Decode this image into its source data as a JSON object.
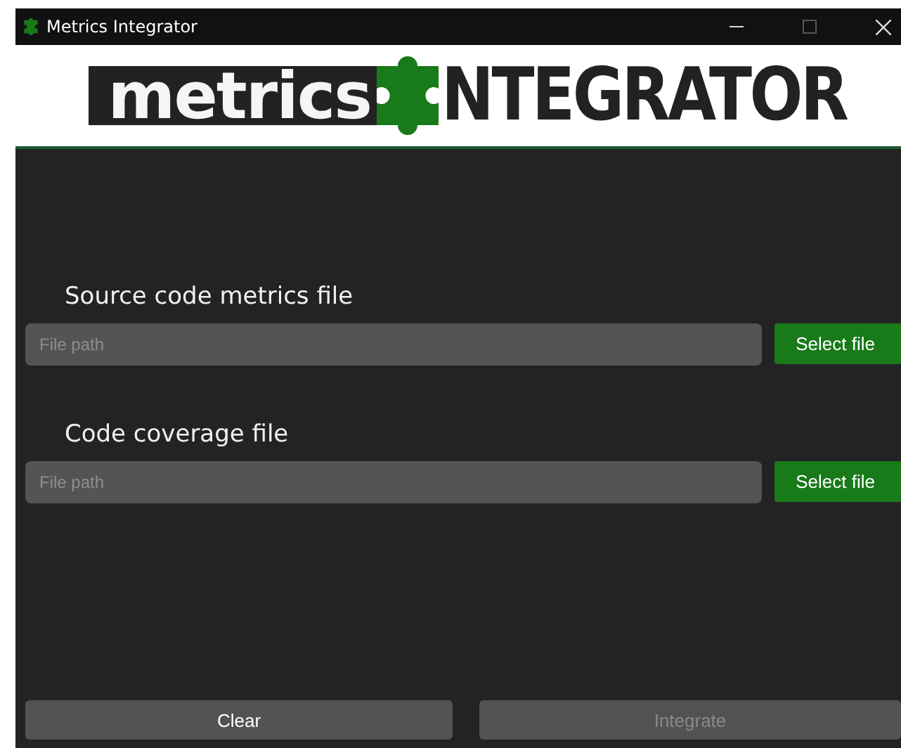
{
  "window": {
    "title": "Metrics Integrator"
  },
  "logo": {
    "left_text": "metrics",
    "right_text": "NTEGRATOR"
  },
  "fields": [
    {
      "label": "Source code metrics file",
      "placeholder": "File path",
      "button": "Select file"
    },
    {
      "label": "Code coverage file",
      "placeholder": "File path",
      "button": "Select file"
    }
  ],
  "actions": [
    {
      "label": "Clear",
      "disabled": false
    },
    {
      "label": "Integrate",
      "disabled": true
    }
  ]
}
